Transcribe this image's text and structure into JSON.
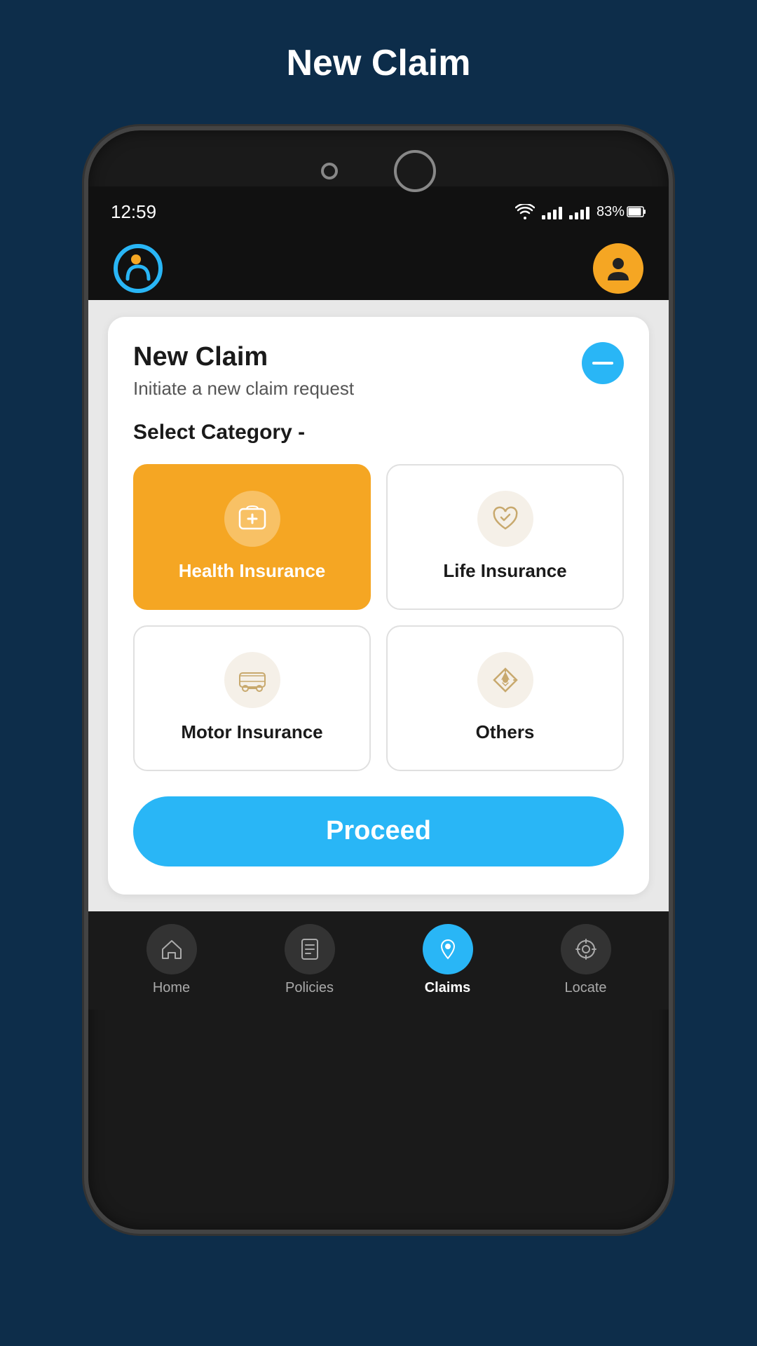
{
  "page": {
    "title": "New Claim",
    "background_color": "#0d2d4a"
  },
  "status_bar": {
    "time": "12:59",
    "battery": "83%"
  },
  "card": {
    "title": "New Claim",
    "subtitle": "Initiate a new claim request",
    "section_label": "Select Category -"
  },
  "categories": [
    {
      "id": "health",
      "label": "Health Insurance",
      "icon": "🏥",
      "selected": true
    },
    {
      "id": "life",
      "label": "Life Insurance",
      "icon": "❤",
      "selected": false
    },
    {
      "id": "motor",
      "label": "Motor Insurance",
      "icon": "🚐",
      "selected": false
    },
    {
      "id": "others",
      "label": "Others",
      "icon": "✈",
      "selected": false
    }
  ],
  "proceed_button": {
    "label": "Proceed"
  },
  "bottom_nav": [
    {
      "id": "home",
      "label": "Home",
      "icon": "🏠",
      "active": false
    },
    {
      "id": "policies",
      "label": "Policies",
      "icon": "📋",
      "active": false
    },
    {
      "id": "claims",
      "label": "Claims",
      "icon": "💰",
      "active": true
    },
    {
      "id": "locate",
      "label": "Locate",
      "icon": "📍",
      "active": false
    }
  ]
}
